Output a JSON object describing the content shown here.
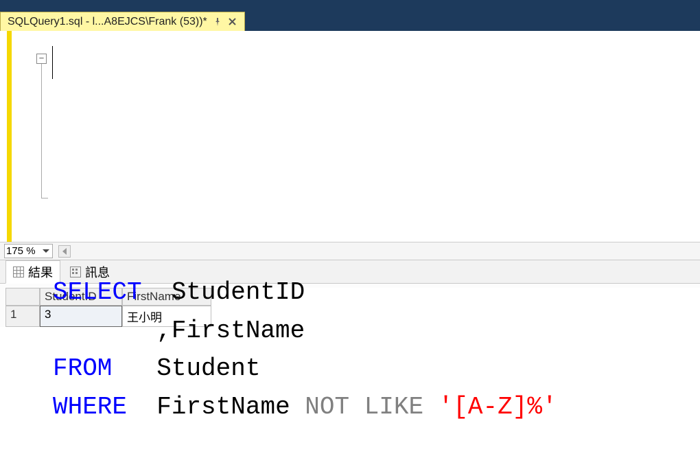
{
  "tab": {
    "title": "SQLQuery1.sql - l...A8EJCS\\Frank (53))*"
  },
  "editor": {
    "fold_symbol": "−",
    "code": {
      "l1_kw": "SELECT",
      "l1_rest": "  StudentID",
      "l2": "       ,FirstName",
      "l3_kw": "FROM",
      "l3_rest": "   Student",
      "l4_kw": "WHERE",
      "l4_mid": "  FirstName ",
      "l4_not": "NOT",
      "l4_like": " LIKE",
      "l4_str": " '[A-Z]%'"
    }
  },
  "zoom": {
    "value": "175 %"
  },
  "results": {
    "tab_results": "結果",
    "tab_messages": "訊息",
    "columns": [
      "StudentID",
      "FirstName"
    ],
    "row_header": "1",
    "rows": [
      {
        "StudentID": "3",
        "FirstName": "王小明"
      }
    ]
  }
}
